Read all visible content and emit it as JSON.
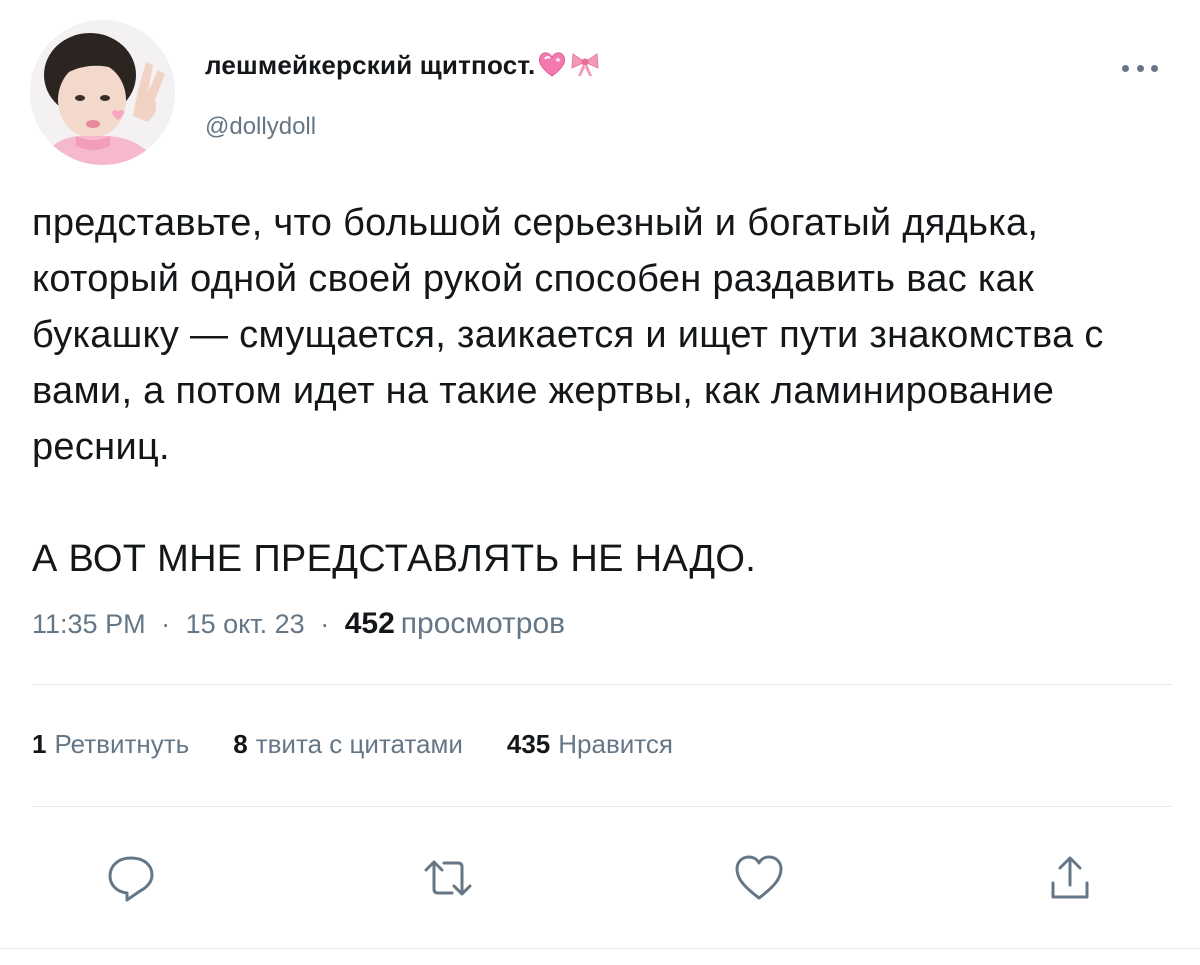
{
  "tweet": {
    "author": {
      "display_name": "лешмейкерский щитпост.",
      "display_name_emojis": [
        "heart-emoji",
        "ribbon-emoji"
      ],
      "handle": "@dollydoll"
    },
    "text": {
      "paragraph_1": "представьте, что большой серьезный и богатый дядька, который одной своей рукой способен раздавить вас как букашку — смущается, заикается и ищет пути знакомства с вами, а потом идет на такие жертвы, как ламинирование ресниц.",
      "paragraph_2": "А ВОТ МНЕ ПРЕДСТАВЛЯТЬ НЕ НАДО."
    },
    "meta": {
      "time": "11:35 PM",
      "separator": "·",
      "date": "15 окт. 23",
      "views_count": "452",
      "views_label": "просмотров"
    },
    "stats": [
      {
        "count": "1",
        "label": "Ретвитнуть"
      },
      {
        "count": "8",
        "label": "твита с цитатами"
      },
      {
        "count": "435",
        "label": "Нравится"
      }
    ],
    "actions": [
      {
        "icon": "reply-icon"
      },
      {
        "icon": "retweet-icon"
      },
      {
        "icon": "like-icon"
      },
      {
        "icon": "share-icon"
      }
    ]
  },
  "colors": {
    "text_primary": "#14171a",
    "text_secondary": "#657786",
    "divider": "#e1e8ed",
    "heart_emoji": "#f27ab0",
    "ribbon_emoji": "#f49ab8"
  }
}
